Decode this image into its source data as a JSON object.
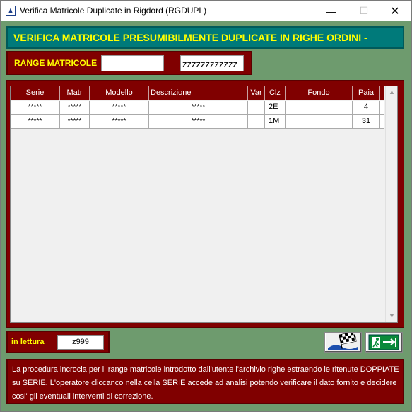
{
  "window": {
    "title": "Verifica Matricole Duplicate in Rigdord (RGDUPL)",
    "minimize": "—",
    "maximize": "☐",
    "close": "✕"
  },
  "header": {
    "title": "VERIFICA MATRICOLE PRESUMIBILMENTE DUPLICATE IN RIGHE ORDINI -"
  },
  "range": {
    "label": "RANGE MATRICOLE",
    "from": "",
    "to": "zzzzzzzzzzzz"
  },
  "grid": {
    "columns": [
      "Serie",
      "Matr",
      "Modello",
      "Descrizione",
      "Var",
      "Clz",
      "Fondo",
      "Paia"
    ],
    "rows": [
      {
        "serie": "*****",
        "matr": "*****",
        "modello": "*****",
        "descrizione": "*****",
        "var": "",
        "clz": "2E",
        "fondo": "",
        "paia": "4"
      },
      {
        "serie": "*****",
        "matr": "*****",
        "modello": "*****",
        "descrizione": "*****",
        "var": "",
        "clz": "1M",
        "fondo": "",
        "paia": "31"
      }
    ]
  },
  "reading": {
    "label": "in lettura",
    "value": "z999"
  },
  "info": {
    "text": "La procedura incrocia per il range matricole introdotto dall'utente l'archivio righe estraendo le ritenute DOPPIATE su SERIE. L'operatore cliccanco nella cella SERIE accede ad analisi potendo verificare il dato fornito e decidere cosi' gli eventuali interventi di correzione."
  },
  "icons": {
    "app": "app-icon",
    "flag": "checkered-flag-icon",
    "exit": "exit-door-icon"
  },
  "colors": {
    "background": "#6e9b6e",
    "header": "#007a7a",
    "panel": "#800000",
    "accent_text": "#ffff00"
  }
}
